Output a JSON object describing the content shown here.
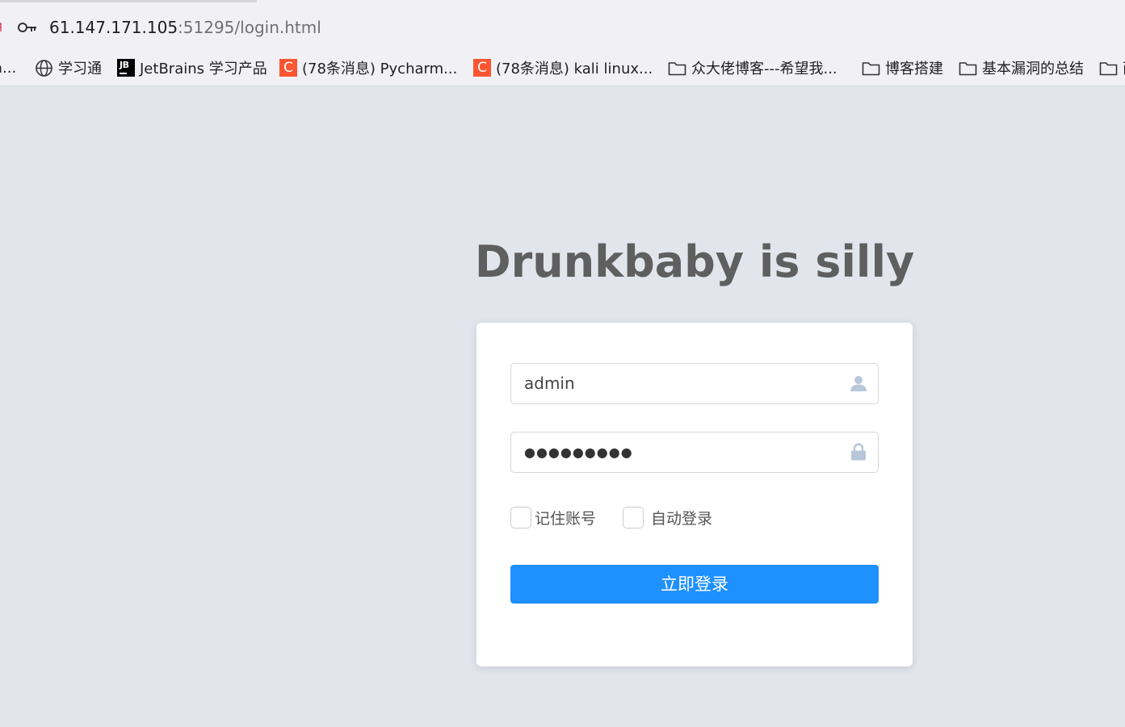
{
  "browser": {
    "url_host": "61.147.171.105",
    "url_path": ":51295/login.html",
    "address_cut_glyph": "q",
    "bookmarks": [
      {
        "label": "a...",
        "icon": "cut-off-icon"
      },
      {
        "label": "学习通",
        "icon": "globe-icon"
      },
      {
        "label": "JetBrains 学习产品",
        "icon": "jetbrains-icon",
        "icon_text": "JB"
      },
      {
        "label": "(78条消息) Pycharm...",
        "icon": "csdn-icon",
        "icon_text": "C"
      },
      {
        "label": "(78条消息) kali linux...",
        "icon": "csdn-icon",
        "icon_text": "C"
      },
      {
        "label": "众大佬博客---希望我...",
        "icon": "folder-icon"
      },
      {
        "label": "博客搭建",
        "icon": "folder-icon"
      },
      {
        "label": "基本漏洞的总结",
        "icon": "folder-icon"
      },
      {
        "label": "西",
        "icon": "folder-icon"
      }
    ]
  },
  "page": {
    "title": "Drunkbaby is silly"
  },
  "login": {
    "username_value": "admin",
    "password_mask": "●●●●●●●●●",
    "remember_label": "记住账号",
    "autologin_label": "自动登录",
    "submit_label": "立即登录"
  },
  "colors": {
    "background": "#e2e6ec",
    "button": "#1e90ff",
    "icon": "#b8c6d9",
    "title": "#5f5f5f"
  }
}
